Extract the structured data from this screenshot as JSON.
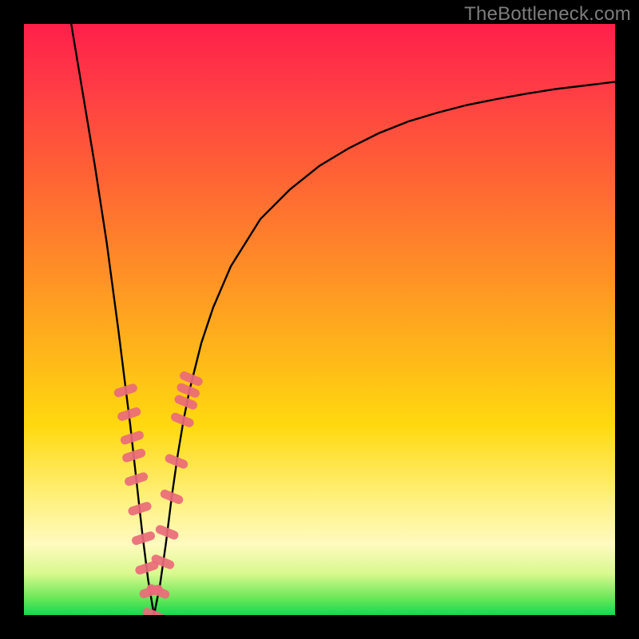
{
  "watermark": "TheBottleneck.com",
  "colors": {
    "curve": "#000000",
    "marker_fill": "#ea6a79",
    "marker_stroke": "#c94b5b",
    "frame": "#000000"
  },
  "chart_data": {
    "type": "line",
    "title": "",
    "xlabel": "",
    "ylabel": "",
    "xlim": [
      0,
      100
    ],
    "ylim": [
      0,
      100
    ],
    "vertex_x": 22,
    "series": [
      {
        "name": "bottleneck-curve",
        "x": [
          8,
          10,
          12,
          14,
          16,
          17,
          18,
          19,
          20,
          21,
          22,
          23,
          24,
          25,
          26,
          27,
          28,
          30,
          32,
          35,
          40,
          45,
          50,
          55,
          60,
          65,
          70,
          75,
          80,
          85,
          90,
          95,
          100
        ],
        "y": [
          100,
          88,
          76,
          63,
          48,
          40,
          32,
          23,
          14,
          6,
          0,
          5,
          12,
          20,
          27,
          33,
          38,
          46,
          52,
          59,
          67,
          72,
          76,
          79,
          81.5,
          83.5,
          85,
          86.3,
          87.3,
          88.2,
          89,
          89.6,
          90.2
        ]
      }
    ],
    "markers": {
      "name": "highlighted-points",
      "x": [
        17.2,
        17.8,
        18.3,
        18.6,
        19.0,
        19.6,
        20.2,
        20.8,
        21.5,
        22.0,
        22.7,
        23.5,
        24.2,
        25.0,
        25.8,
        26.8,
        27.4,
        27.8,
        28.3
      ],
      "y": [
        38,
        34,
        30,
        27,
        23,
        18,
        13,
        8,
        4,
        0,
        4,
        9,
        14,
        20,
        26,
        33,
        36,
        38,
        40
      ]
    }
  }
}
